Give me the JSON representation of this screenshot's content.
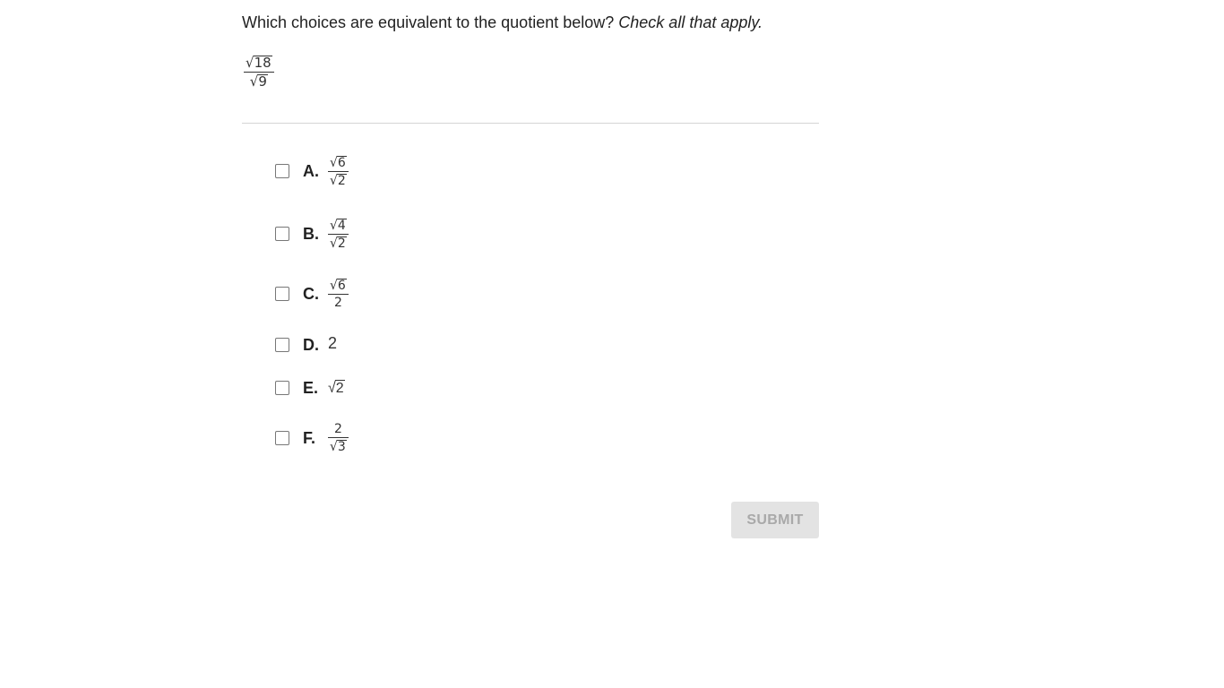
{
  "question": {
    "text": "Which choices are equivalent to the quotient below?",
    "instruction": "Check all that apply."
  },
  "expression": {
    "numerator_radicand": "18",
    "denominator_radicand": "9"
  },
  "options": [
    {
      "letter": "A.",
      "numerator_radicand": "6",
      "denominator_radicand": "2"
    },
    {
      "letter": "B.",
      "numerator_radicand": "4",
      "denominator_radicand": "2"
    },
    {
      "letter": "C.",
      "numerator_radicand": "6",
      "denominator": "2"
    },
    {
      "letter": "D.",
      "value": "2"
    },
    {
      "letter": "E.",
      "radicand": "2"
    },
    {
      "letter": "F.",
      "numerator": "2",
      "denominator_radicand": "3"
    }
  ],
  "submit": {
    "label": "SUBMIT",
    "enabled": false
  }
}
